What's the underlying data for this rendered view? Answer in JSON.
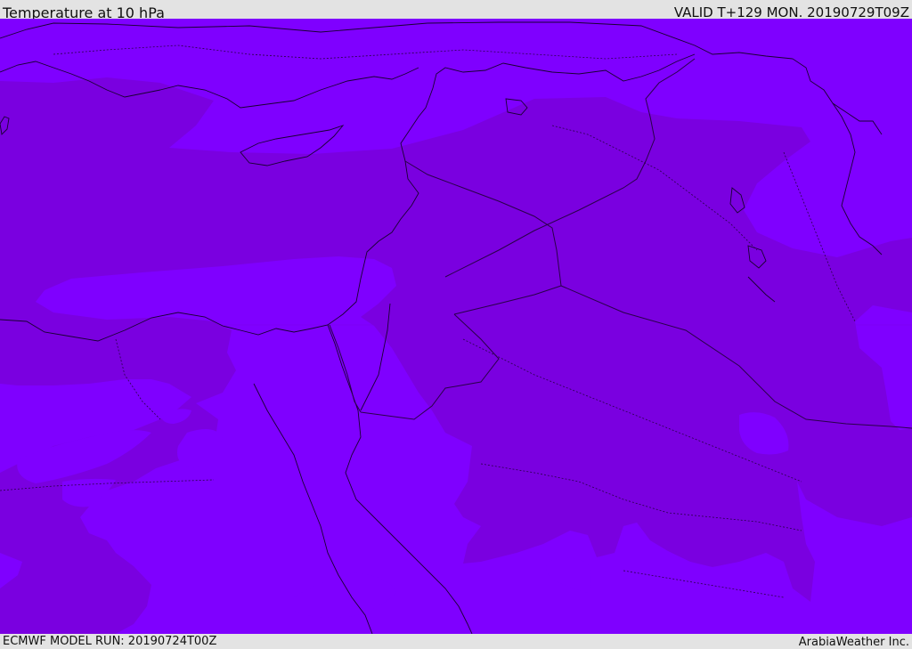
{
  "header": {
    "title": "Temperature at 10 hPa",
    "valid": "VALID T+129 MON. 20190729T09Z"
  },
  "footer": {
    "model_run": "ECMWF MODEL RUN: 20190724T00Z",
    "credit": "ArabiaWeather Inc."
  },
  "map": {
    "colors": {
      "warm_band": "#7f00ff",
      "cool_band": "#7a00e0",
      "coastline": "#1a0033",
      "border": "#2a004a"
    }
  }
}
